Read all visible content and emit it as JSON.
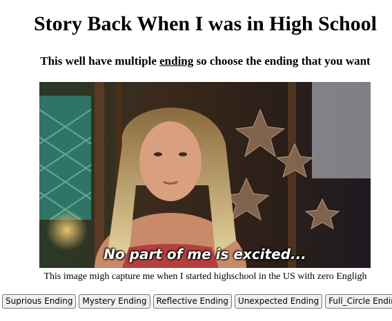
{
  "page": {
    "title": "Story Back When I was in High School",
    "subtitle_before": "This well have multiple ",
    "subtitle_underlined": "ending",
    "subtitle_after": " so choose the ending that you want"
  },
  "image": {
    "overlay_text": "No part of me is excited...",
    "caption": "This image migh capture me when I started highschool in the US with zero Engligh"
  },
  "buttons": [
    {
      "label": "Suprious Ending"
    },
    {
      "label": "Mystery Ending"
    },
    {
      "label": "Reflective Ending"
    },
    {
      "label": "Unexpected Ending"
    },
    {
      "label": "Full_Circle Ending"
    }
  ],
  "colors": {
    "button_bg": "#efefef",
    "button_border": "#767676"
  }
}
